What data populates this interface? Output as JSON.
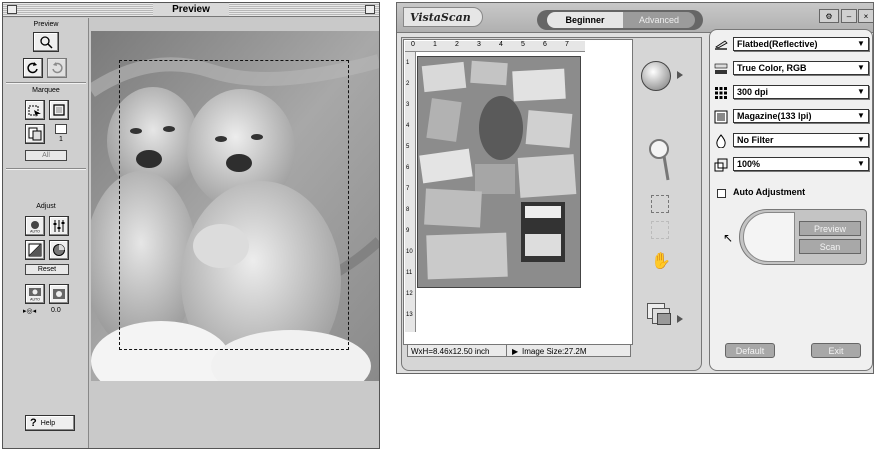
{
  "preview_window": {
    "title": "Preview",
    "sections": {
      "preview": "Preview",
      "marquee": "Marquee",
      "adjust": "Adjust"
    },
    "marquee_counter": "1",
    "all_button": "All",
    "reset_button": "Reset",
    "exposure_value": "0.0",
    "help_button": "Help"
  },
  "vistascan": {
    "logo": "VistaScan",
    "tabs": {
      "beginner": "Beginner",
      "advanced": "Advanced"
    },
    "ruler_top_numbers": [
      "0",
      "1",
      "2",
      "3",
      "4",
      "5",
      "6",
      "7"
    ],
    "ruler_left_numbers": [
      "1",
      "2",
      "3",
      "4",
      "5",
      "6",
      "7",
      "8",
      "9",
      "10",
      "11",
      "12",
      "13"
    ],
    "status": {
      "dimensions": "WxH=8.46x12.50 inch",
      "image_size": "Image Size:27.2M"
    },
    "settings": {
      "source": "Flatbed(Reflective)",
      "color": "True Color, RGB",
      "resolution": "300 dpi",
      "purpose": "Magazine(133 lpi)",
      "filter": "No Filter",
      "scale": "100%"
    },
    "auto_adjustment": {
      "label": "Auto Adjustment",
      "checked": false
    },
    "buttons": {
      "preview": "Preview",
      "scan": "Scan",
      "default": "Default",
      "exit": "Exit"
    }
  }
}
